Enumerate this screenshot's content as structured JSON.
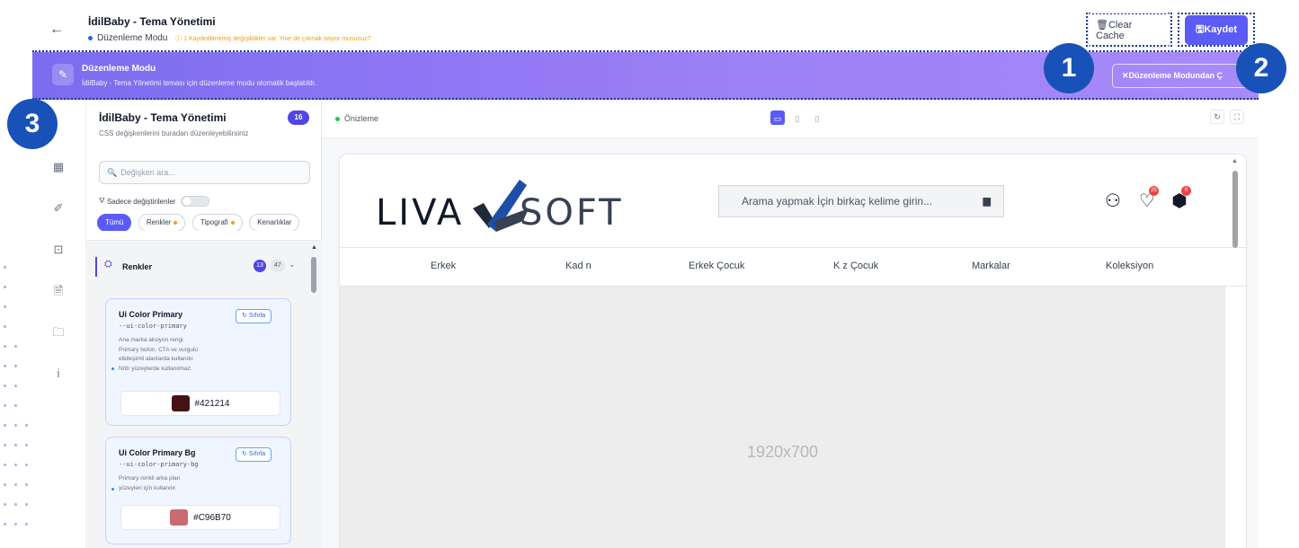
{
  "header": {
    "title": "İdilBaby - Tema Yönetimi",
    "mode_label": "Düzenleme Modu",
    "warning": "1 Kaydedilmemiş değişiklikler var. Yine de çıkmak istiyor musunuz?",
    "clear_cache": "Clear Cache",
    "save": "Kaydet"
  },
  "banner": {
    "title": "Düzenleme Modu",
    "description": "İdilBaby - Tema Yönetimi teması için düzenleme modu otomatik başlatıldı.",
    "exit_button": "Düzenleme Modundan Ç"
  },
  "callouts": [
    "1",
    "2",
    "3"
  ],
  "panel": {
    "title": "İdilBaby - Tema Yönetimi",
    "subtitle": "CSS değişkenlerini buradan düzenleyebilirsiniz",
    "count": "16",
    "search_placeholder": "Değişken ara...",
    "only_changed": "Sadece değiştirilenler",
    "chips": [
      "Tümü",
      "Renkler",
      "Tipografi",
      "Kenarlıklar"
    ],
    "section": {
      "label": "Renkler",
      "count_changed": "13",
      "count_total": "47"
    },
    "reset_label": "Sıfırla",
    "variables": [
      {
        "name": "Ui Color Primary",
        "key": "--ui-color-primary",
        "desc_lines": [
          "Ana marka aksiyon rengi.",
          "Primary buton, CTA ve vurgulu",
          "etkileşimli alanlarda kullanılır.",
          "Nötr yüzeylerde kullanılmaz."
        ],
        "value": "#421214",
        "color": "#421214"
      },
      {
        "name": "Ui Color Primary Bg",
        "key": "--ui-color-primary-bg",
        "desc_lines": [
          "Primary renkli arka plan",
          "yüzeyleri için kullanılır."
        ],
        "value": "#C96B70",
        "color": "#C96B70"
      }
    ]
  },
  "preview": {
    "label": "Önizleme",
    "site": {
      "logo_left": "LIVA",
      "logo_right": "SOFT",
      "search_placeholder": "Arama yapmak İçin birkaç kelime girin...",
      "wishlist_count": "25",
      "cart_count": "0",
      "nav": [
        "Erkek",
        "Kad n",
        "Erkek Çocuk",
        "K z Çocuk",
        "Markalar",
        "Koleksiyon"
      ],
      "hero_placeholder": "1920x700"
    }
  },
  "colors": {
    "accent": "#5b5bf6",
    "banner_start": "#7c6cf0",
    "banner_end": "#a78bfa",
    "callout": "#1852b8",
    "logo_mark_dark": "#1f2937",
    "logo_mark_blue": "#1e4fa8"
  }
}
